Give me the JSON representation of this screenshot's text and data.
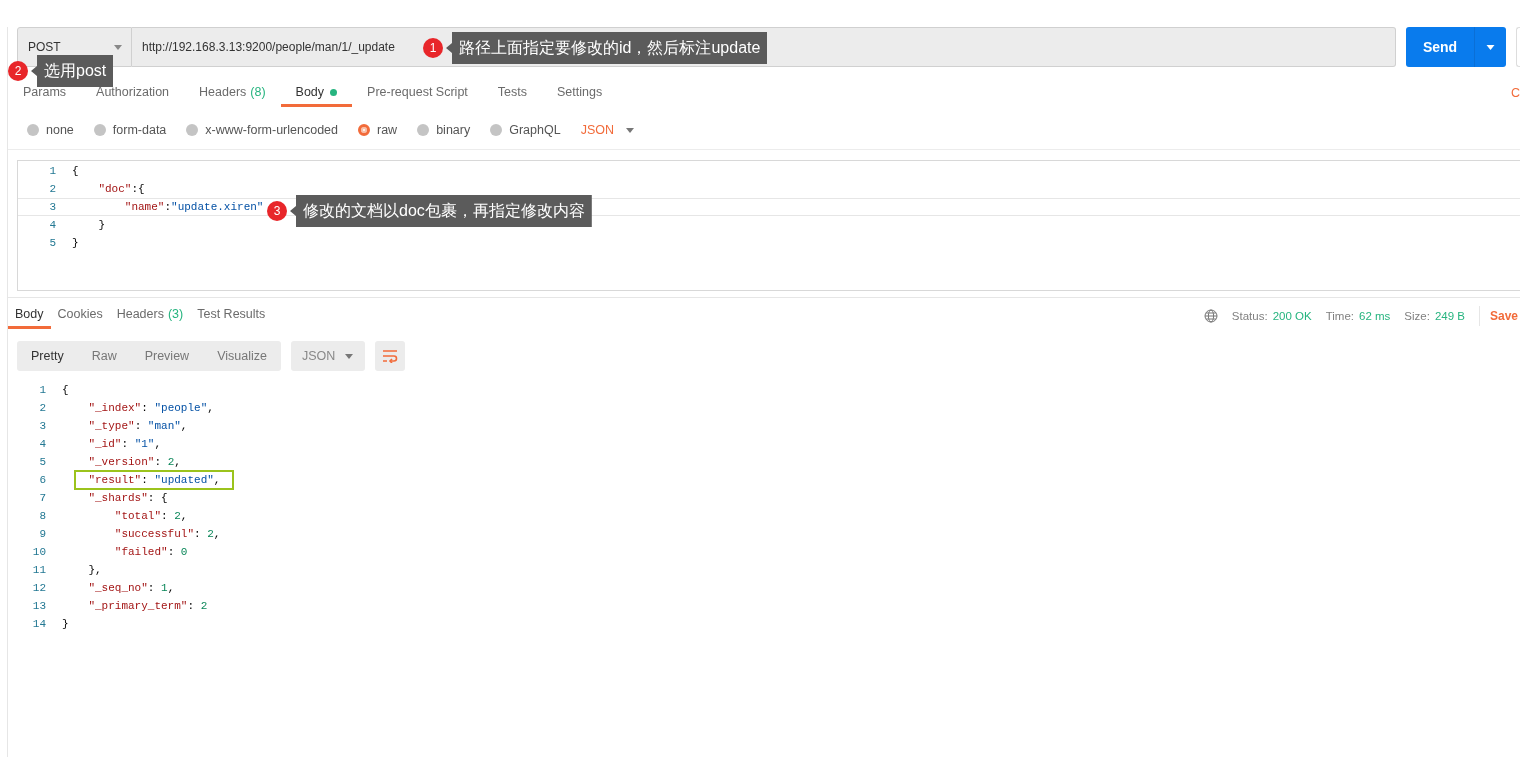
{
  "request": {
    "method": "POST",
    "url": "http://192.168.3.13:9200/people/man/1/_update",
    "send_label": "Send"
  },
  "request_tabs": [
    {
      "label": "Params",
      "dot": false,
      "selected": false
    },
    {
      "label": "Authorization",
      "dot": false,
      "selected": false
    },
    {
      "label": "Headers",
      "count": "(8)",
      "dot": false,
      "selected": false
    },
    {
      "label": "Body",
      "dot": true,
      "selected": true
    },
    {
      "label": "Pre-request Script",
      "dot": false,
      "selected": false
    },
    {
      "label": "Tests",
      "dot": false,
      "selected": false
    },
    {
      "label": "Settings",
      "dot": false,
      "selected": false
    }
  ],
  "cookies_link": "C",
  "body_types": [
    {
      "label": "none",
      "selected": false
    },
    {
      "label": "form-data",
      "selected": false
    },
    {
      "label": "x-www-form-urlencoded",
      "selected": false
    },
    {
      "label": "raw",
      "selected": true
    },
    {
      "label": "binary",
      "selected": false
    },
    {
      "label": "GraphQL",
      "selected": false
    }
  ],
  "body_format": "JSON",
  "request_body": {
    "lines": [
      {
        "number": "1",
        "code": "{",
        "active": false
      },
      {
        "number": "2",
        "code": "    \"doc\":{",
        "active": false
      },
      {
        "number": "3",
        "code": "        \"name\":\"update.xiren\"",
        "active": true
      },
      {
        "number": "4",
        "code": "    }",
        "active": false
      },
      {
        "number": "5",
        "code": "}",
        "active": false
      }
    ]
  },
  "response_tabs": [
    {
      "label": "Body",
      "selected": true
    },
    {
      "label": "Cookies",
      "selected": false
    },
    {
      "label": "Headers",
      "count": "(3)",
      "selected": false
    },
    {
      "label": "Test Results",
      "selected": false
    }
  ],
  "response_meta": [
    {
      "label": "Status:",
      "value": "200 OK"
    },
    {
      "label": "Time:",
      "value": "62 ms"
    },
    {
      "label": "Size:",
      "value": "249 B"
    }
  ],
  "save_label": "Save",
  "view_modes": [
    {
      "label": "Pretty",
      "selected": true
    },
    {
      "label": "Raw",
      "selected": false
    },
    {
      "label": "Preview",
      "selected": false
    },
    {
      "label": "Visualize",
      "selected": false
    }
  ],
  "response_format": "JSON",
  "response_body": {
    "lines": [
      {
        "number": "1",
        "code": "{",
        "highlighted": false
      },
      {
        "number": "2",
        "code": "    \"_index\": \"people\",",
        "highlighted": false
      },
      {
        "number": "3",
        "code": "    \"_type\": \"man\",",
        "highlighted": false
      },
      {
        "number": "4",
        "code": "    \"_id\": \"1\",",
        "highlighted": false
      },
      {
        "number": "5",
        "code": "    \"_version\": 2,",
        "highlighted": false
      },
      {
        "number": "6",
        "code": "    \"result\": \"updated\",",
        "highlighted": true
      },
      {
        "number": "7",
        "code": "    \"_shards\": {",
        "highlighted": false
      },
      {
        "number": "8",
        "code": "        \"total\": 2,",
        "highlighted": false
      },
      {
        "number": "9",
        "code": "        \"successful\": 2,",
        "highlighted": false
      },
      {
        "number": "10",
        "code": "        \"failed\": 0",
        "highlighted": false
      },
      {
        "number": "11",
        "code": "    },",
        "highlighted": false
      },
      {
        "number": "12",
        "code": "    \"_seq_no\": 1,",
        "highlighted": false
      },
      {
        "number": "13",
        "code": "    \"_primary_term\": 2",
        "highlighted": false
      },
      {
        "number": "14",
        "code": "}",
        "highlighted": false
      }
    ]
  },
  "annotations": [
    {
      "number": "1",
      "text": "路径上面指定要修改的id，然后标注update"
    },
    {
      "number": "2",
      "text": "选用post"
    },
    {
      "number": "3",
      "text": "修改的文档以doc包裹，再指定修改内容"
    }
  ]
}
